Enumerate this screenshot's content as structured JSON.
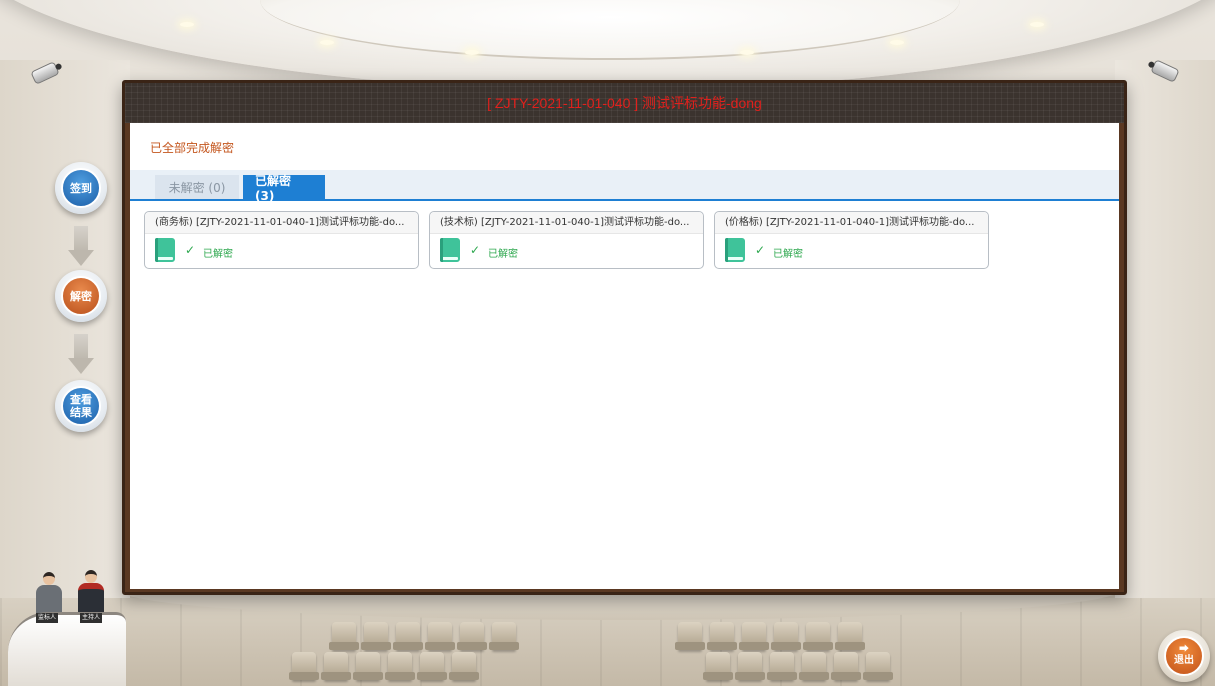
{
  "screen": {
    "title": "[ ZJTY-2021-11-01-040 ] 测试评标功能-dong",
    "status": "已全部完成解密"
  },
  "tabs": [
    {
      "label": "未解密 (0)",
      "active": false
    },
    {
      "label": "已解密 (3)",
      "active": true
    }
  ],
  "cards": [
    {
      "title": "(商务标) [ZJTY-2021-11-01-040-1]测试评标功能-do...",
      "icon": "book-icon",
      "status": "已解密"
    },
    {
      "title": "(技术标) [ZJTY-2021-11-01-040-1]测试评标功能-do...",
      "icon": "book-icon",
      "status": "已解密"
    },
    {
      "title": "(价格标) [ZJTY-2021-11-01-040-1]测试评标功能-do...",
      "icon": "book-icon",
      "status": "已解密"
    }
  ],
  "steps": [
    {
      "label": "签到",
      "icon": "blue-circle"
    },
    {
      "label": "解密",
      "icon": "orange-circle"
    },
    {
      "label": "查看结果",
      "line1": "查看",
      "line2": "结果",
      "icon": "blue-circle"
    }
  ],
  "hosts": {
    "judge_plate": "监标人",
    "host_plate": "主持人"
  },
  "exit": {
    "label": "退出",
    "icon": "exit-icon"
  },
  "colors": {
    "title_red": "#e0201c",
    "status_orange": "#c4561e",
    "tab_blue": "#1e7fd3",
    "success_green": "#2ea84f",
    "book_teal": "#3fc39a"
  }
}
